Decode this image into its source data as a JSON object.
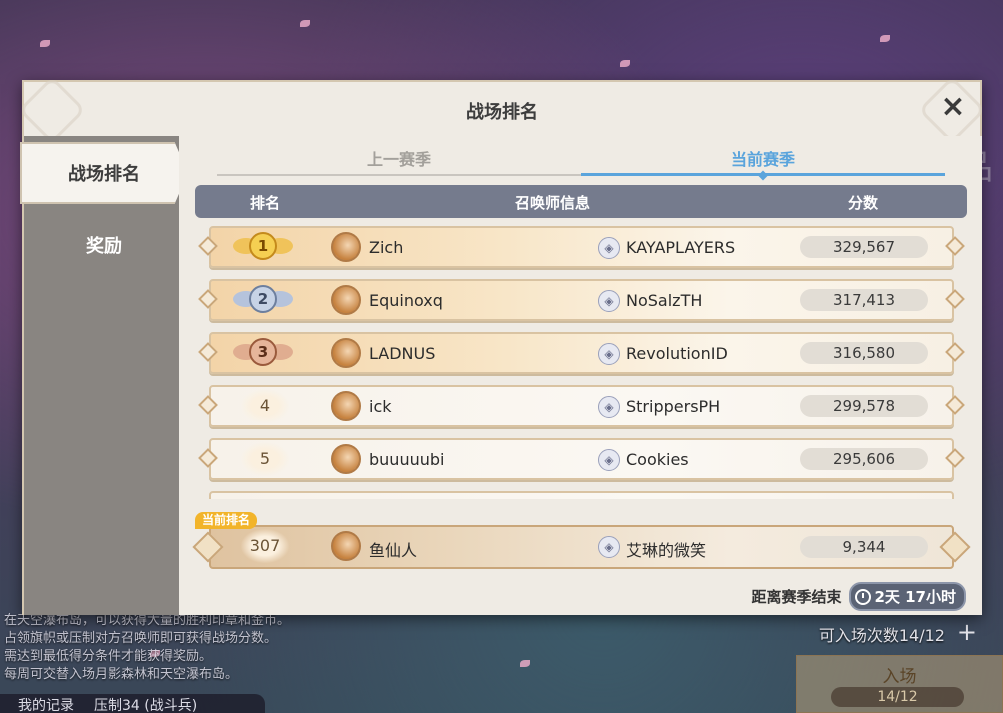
{
  "dialog": {
    "title": "战场排名",
    "close_icon": "×"
  },
  "sidebar": {
    "tabs": [
      {
        "label": "战场排名",
        "active": true
      },
      {
        "label": "奖励",
        "active": false
      }
    ]
  },
  "season_tabs": [
    {
      "label": "上一赛季",
      "active": false
    },
    {
      "label": "当前赛季",
      "active": true
    }
  ],
  "table": {
    "columns": [
      "排名",
      "召唤师信息",
      "分数"
    ],
    "rows": [
      {
        "rank": "1",
        "name": "Zich",
        "guild": "KAYAPLAYERS",
        "score": "329,567"
      },
      {
        "rank": "2",
        "name": "Equinoxq",
        "guild": "NoSalzTH",
        "score": "317,413"
      },
      {
        "rank": "3",
        "name": "LADNUS",
        "guild": "RevolutionID",
        "score": "316,580"
      },
      {
        "rank": "4",
        "name": "ick",
        "guild": "StrippersPH",
        "score": "299,578"
      },
      {
        "rank": "5",
        "name": "buuuuubi",
        "guild": "Cookies",
        "score": "295,606"
      }
    ]
  },
  "current": {
    "badge": "当前排名",
    "rank": "307",
    "name": "鱼仙人",
    "guild": "艾琳的微笑",
    "score": "9,344"
  },
  "season_end": {
    "label": "距离赛季结束",
    "countdown": "2天 17小时",
    "icon": "clock-icon"
  },
  "background": {
    "info_lines": [
      "在天空瀑布岛，可以获得大量的胜利印章和金币。",
      "占领旗帜或压制对方召唤师即可获得战场分数。",
      "需达到最低得分条件才能获得奖励。",
      "每周可交替入场月影森林和天空瀑布岛。"
    ],
    "my_record": "我的记录",
    "suppress": "压制34 (战斗兵)",
    "entries": "可入场次数14/12",
    "plus": "+",
    "enter_label": "入场",
    "enter_count": "14/12"
  },
  "colors": {
    "accent_blue": "#5aa4dc",
    "header_bg": "#757b8d",
    "badge_orange": "#f2b42a",
    "gold": "#e3a93b",
    "silver": "#8fa2c2",
    "bronze": "#c98d6a"
  }
}
